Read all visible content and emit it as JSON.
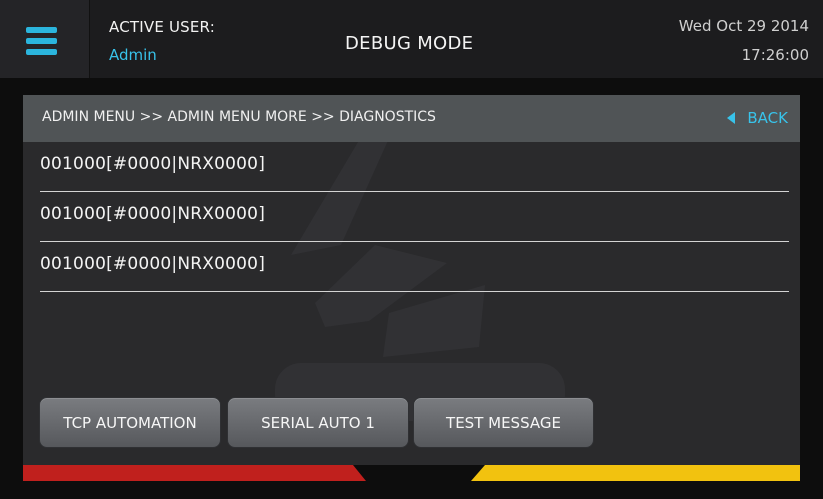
{
  "header": {
    "active_user_label": "ACTIVE USER:",
    "active_user": "Admin",
    "mode_title": "DEBUG MODE",
    "date": "Wed Oct 29 2014",
    "time": "17:26:00",
    "menu_icon": "hamburger-menu-icon"
  },
  "navigation": {
    "breadcrumb": "ADMIN MENU >> ADMIN MENU MORE >> DIAGNOSTICS",
    "back_label": "BACK",
    "back_icon": "triangle-left-icon"
  },
  "diagnostics": {
    "rows": [
      "001000[#0000|NRX0000]",
      "001000[#0000|NRX0000]",
      "001000[#0000|NRX0000]"
    ]
  },
  "buttons": {
    "tcp_automation": "TCP AUTOMATION",
    "serial_auto_1": "SERIAL AUTO 1",
    "test_message": "TEST MESSAGE"
  },
  "colors": {
    "accent": "#38c3ea",
    "header_bg": "#1c1c1e",
    "panel_bg": "#2a2a2c",
    "breadcrumb_bg": "#505456",
    "stripe_red": "#c0201d",
    "stripe_yellow": "#f2c20f"
  }
}
